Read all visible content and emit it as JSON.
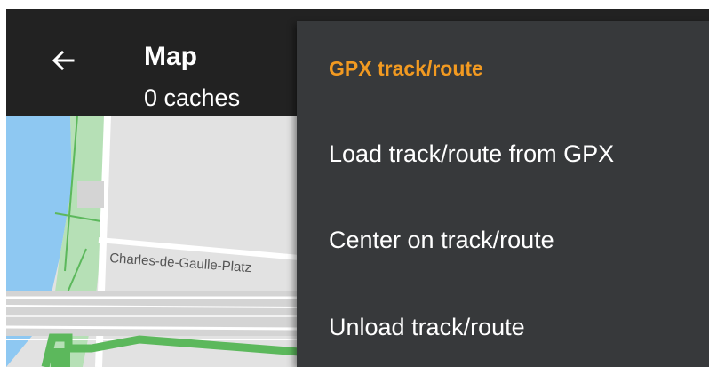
{
  "toolbar": {
    "back_icon": "arrow-left-icon",
    "title": "Map",
    "subtitle": "0 caches"
  },
  "map": {
    "street_label": "Charles-de-Gaulle-Platz"
  },
  "menu": {
    "header": "GPX track/route",
    "items": [
      {
        "label": "Load track/route from GPX"
      },
      {
        "label": "Center on track/route"
      },
      {
        "label": "Unload track/route"
      }
    ]
  },
  "colors": {
    "toolbar_bg": "#222222",
    "menu_bg": "#37393b",
    "accent": "#f29a21",
    "water": "#8ec8f2",
    "park": "#9ad29a",
    "map_bg": "#e2e2e2"
  }
}
